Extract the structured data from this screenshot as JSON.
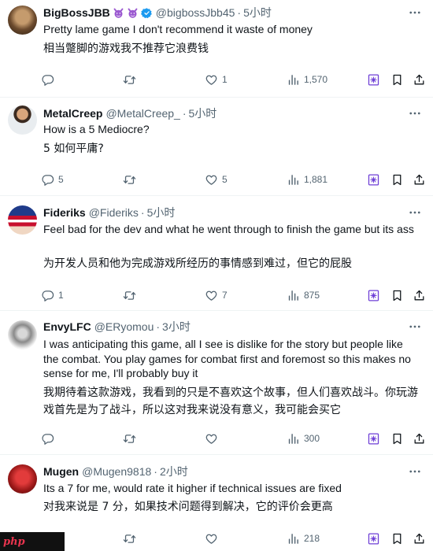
{
  "tweets": [
    {
      "name": "BigBossJBB",
      "handle": "@bigbossJbb45",
      "time": "5小时",
      "text": "Pretty lame game I don't recommend it waste of money",
      "translation": "相当蹩脚的游戏我不推荐它浪费钱",
      "replies": "",
      "likes": "1",
      "views": "1,570"
    },
    {
      "name": "MetalCreep",
      "handle": "@MetalCreep_",
      "time": "5小时",
      "text": "How is a 5 Mediocre?",
      "translation": "5 如何平庸?",
      "replies": "5",
      "likes": "5",
      "views": "1,881"
    },
    {
      "name": "Fideriks",
      "handle": "@Fideriks",
      "time": "5小时",
      "text": "Feel bad for the dev and what he went through to finish the game but its ass",
      "translation": "为开发人员和他为完成游戏所经历的事情感到难过，但它的屁股",
      "replies": "1",
      "likes": "7",
      "views": "875"
    },
    {
      "name": "EnvyLFC",
      "handle": "@ERyomou",
      "time": "3小时",
      "text": "I was anticipating this game, all I see is dislike for the story but people like the combat. You play games for combat first and foremost so this makes no sense for me, I'll probably buy it",
      "translation": "我期待着这款游戏，我看到的只是不喜欢这个故事，但人们喜欢战斗。你玩游戏首先是为了战斗，所以这对我来说没有意义，我可能会买它",
      "replies": "",
      "likes": "",
      "views": "300"
    },
    {
      "name": "Mugen",
      "handle": "@Mugen9818",
      "time": "2小时",
      "text": "Its a 7 for me, would rate it higher if technical issues are fixed",
      "translation": "对我来说是 7 分，如果技术问题得到解决，它的评价会更高",
      "replies": "",
      "likes": "",
      "views": "218"
    }
  ],
  "separator": "·",
  "watermark": "php",
  "colors": {
    "text": "#0f1419",
    "muted": "#536471",
    "verified": "#1d9bf0",
    "grok": "#6e3fd6",
    "divider": "#eff3f4"
  },
  "icons": [
    "reply-icon",
    "retweet-icon",
    "like-icon",
    "views-icon",
    "grok-icon",
    "bookmark-icon",
    "share-icon",
    "more-icon",
    "verified-icon",
    "devil-emoji-icon"
  ]
}
